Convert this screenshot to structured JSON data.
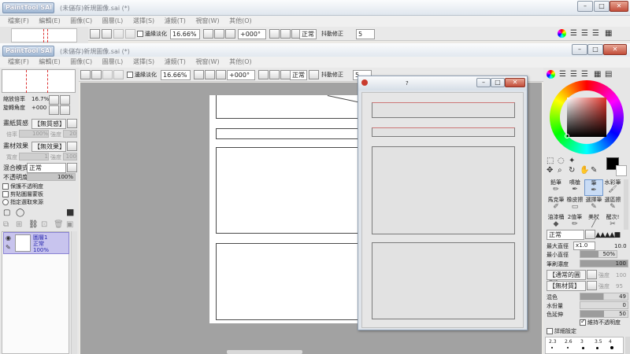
{
  "back_window": {
    "logo": "PaintTool SAI",
    "title": "(未儲存)新規圖像.sai (*)",
    "menu": [
      "檔案(F)",
      "編輯(E)",
      "圖像(C)",
      "圖層(L)",
      "選擇(S)",
      "濾鏡(T)",
      "視窗(W)",
      "其他(O)"
    ],
    "zoom": "16.66%",
    "angle": "+000°",
    "antialias_label": "邊緣淡化",
    "blend_mode": "正常",
    "stabilizer_label": "抖動修正",
    "stabilizer_value": "5"
  },
  "window": {
    "logo": "PaintTool SAI",
    "title": "(未儲存)新規圖像.sai (*)",
    "menu": [
      "檔案(F)",
      "編輯(E)",
      "圖像(C)",
      "圖層(L)",
      "選擇(S)",
      "濾鏡(T)",
      "視窗(W)",
      "其他(O)"
    ],
    "controls": {
      "minimize": "–",
      "maximize": "□",
      "close": "✕"
    }
  },
  "toolbar": {
    "antialias_label": "邊緣淡化",
    "zoom": "16.66%",
    "angle": "+000°",
    "blend_mode": "正常",
    "stabilizer_label": "抖動修正",
    "stabilizer_value": "5"
  },
  "left_panel": {
    "zoom_label": "縮放倍率",
    "zoom_value": "16.7%",
    "rotate_label": "旋轉角度",
    "rotate_value": "+000",
    "paper_texture_label": "畫紙質感",
    "paper_texture_value": "【無質感】",
    "scale_label": "倍率",
    "scale_value": "100%",
    "strength_label": "強度",
    "strength_value": "20",
    "material_effect_label": "畫材效果",
    "material_effect_value": "【無效果】",
    "width_label": "寬度",
    "width_value": "1",
    "strength2_label": "強度",
    "strength2_value": "100",
    "blend_mode_label": "混合模式",
    "blend_mode_value": "正常",
    "opacity_label": "不透明度",
    "opacity_value": "100%",
    "checks": [
      "保護不透明度",
      "剪貼圖層蒙板",
      "指定選取來源"
    ],
    "layer": {
      "name": "圖層1",
      "mode": "正常",
      "opacity": "100%"
    }
  },
  "dialog": {
    "title": "?",
    "controls": {
      "minimize": "–",
      "maximize": "□",
      "close": "✕"
    }
  },
  "right_panel": {
    "brushes": [
      {
        "label": "鉛筆",
        "icon": "pencil-icon"
      },
      {
        "label": "噴槍",
        "icon": "airbrush-icon"
      },
      {
        "label": "筆",
        "icon": "pen-icon"
      },
      {
        "label": "水彩筆",
        "icon": "watercolor-icon"
      },
      {
        "label": "馬克筆",
        "icon": "marker-icon"
      },
      {
        "label": "橡皮擦",
        "icon": "eraser-icon"
      },
      {
        "label": "選擇筆",
        "icon": "select-pen-icon"
      },
      {
        "label": "選區擦",
        "icon": "select-eraser-icon"
      },
      {
        "label": "油漆桶",
        "icon": "bucket-icon"
      },
      {
        "label": "2值筆",
        "icon": "binary-pen-icon"
      },
      {
        "label": "美杖",
        "icon": "wand-icon"
      },
      {
        "label": "醒次!",
        "icon": "brush-icon"
      }
    ],
    "brush_mode": "正常",
    "max_size_label": "最大直徑",
    "max_size_mult": "x1.0",
    "max_size_value": "10.0",
    "min_size_label": "最小直徑",
    "min_size_value": "50%",
    "density_label": "筆刷濃度",
    "density_value": "100",
    "shape_value": "【通常的圓形】",
    "shape_strength_label": "強度",
    "shape_strength_value": "100",
    "texture_value": "【無材質】",
    "texture_strength_label": "強度",
    "texture_strength_value": "95",
    "mix_label": "混色",
    "mix_value": "49",
    "water_label": "水份量",
    "water_value": "0",
    "extend_label": "色延伸",
    "extend_value": "50",
    "keep_opacity_label": "維持不透明度",
    "detail_label": "詳細設定",
    "size_presets": [
      "2.3",
      "2.6",
      "3",
      "3.5",
      "4"
    ],
    "colors": {
      "primary": "#000000",
      "secondary": "#ffffff",
      "accent": "#c93b2e"
    }
  }
}
